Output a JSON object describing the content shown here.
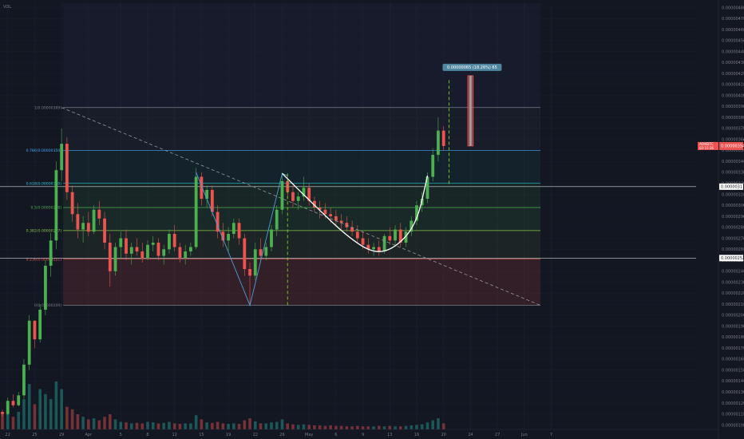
{
  "indicator_label": "VOL",
  "colors": {
    "background": "#131722",
    "up": "#26a69a",
    "down": "#ef5350",
    "up_candle": "#4caf50",
    "pattern_line": "#4f9fd8",
    "cup_line": "#ffffff",
    "target_dash": "#7ed321",
    "last_price_bg": "#ef5350"
  },
  "chart_data": {
    "type": "candlestick",
    "price_axis": {
      "ylim": [
        9.6e-07,
        4.84e-06
      ],
      "ticks": [
        "0.00000480",
        "0.00000470",
        "0.00000460",
        "0.00000450",
        "0.00000440",
        "0.00000430",
        "0.00000420",
        "0.00000410",
        "0.00000400",
        "0.00000390",
        "0.00000380",
        "0.00000370",
        "0.00000360",
        "0.00000350",
        "0.00000340",
        "0.00000330",
        "0.00000320",
        "0.00000310",
        "0.00000300",
        "0.00000290",
        "0.00000280",
        "0.00000270",
        "0.00000260",
        "0.00000250",
        "0.00000240",
        "0.00000230",
        "0.00000220",
        "0.00000210",
        "0.00000200",
        "0.00000190",
        "0.00000180",
        "0.00000170",
        "0.00000160",
        "0.00000150",
        "0.00000140",
        "0.00000130",
        "0.00000120",
        "0.00000110",
        "0.00000100"
      ],
      "badges": [
        {
          "label": "0.00000317",
          "value": 3.17e-06
        },
        {
          "label": "0.00000252",
          "value": 2.52e-06
        }
      ],
      "symbol_tag": "ARKBTC",
      "last_price": {
        "label": "0.00000354",
        "value": 3.54e-06,
        "sub": "02:15:36"
      }
    },
    "time_axis": {
      "labels": [
        "22",
        "25",
        "29",
        "Apr",
        "5",
        "8",
        "12",
        "15",
        "19",
        "22",
        "26",
        "May",
        "6",
        "9",
        "13",
        "16",
        "20",
        "24",
        "27",
        "Jun",
        "7"
      ],
      "index_positions": [
        1,
        6,
        11,
        16,
        22,
        27,
        32,
        37,
        42,
        47,
        52,
        57,
        62,
        67,
        72,
        77,
        82,
        87,
        92,
        97,
        102
      ]
    },
    "fib_levels": [
      {
        "label": "1(0.00000389)",
        "ratio": 1,
        "value": 3.89e-06
      },
      {
        "label": "0.786(0.00000350)",
        "ratio": 0.786,
        "value": 3.5e-06
      },
      {
        "label": "0.618(0.00000320)",
        "ratio": 0.618,
        "value": 3.2e-06
      },
      {
        "label": "0.5(0.00000298)",
        "ratio": 0.5,
        "value": 2.98e-06
      },
      {
        "label": "0.382(0.00000277)",
        "ratio": 0.382,
        "value": 2.77e-06
      },
      {
        "label": "0.236(0.00000251)",
        "ratio": 0.236,
        "value": 2.51e-06
      },
      {
        "label": "0(0.00000209)",
        "ratio": 0,
        "value": 2.09e-06
      }
    ],
    "fib_range_index": [
      11,
      100
    ],
    "trendline": [
      {
        "i": 11,
        "v": 3.89e-06
      },
      {
        "i": 100,
        "v": 2.09e-06
      }
    ],
    "pattern_line": [
      {
        "i": 36,
        "v": 3.3e-06
      },
      {
        "i": 46,
        "v": 2.09e-06
      },
      {
        "i": 52,
        "v": 3.29e-06
      },
      {
        "i": 53,
        "v": 3.27e-06
      }
    ],
    "cup_line": [
      {
        "i": 52,
        "v": 3.29e-06
      },
      {
        "i": 58,
        "v": 3e-06
      },
      {
        "i": 64,
        "v": 2.72e-06
      },
      {
        "i": 69,
        "v": 2.56e-06
      },
      {
        "i": 73,
        "v": 2.61e-06
      },
      {
        "i": 77,
        "v": 2.83e-06
      },
      {
        "i": 79,
        "v": 3.27e-06
      }
    ],
    "vertical_dashes": [
      {
        "i": 53,
        "from": 2.09e-06,
        "to": 3.29e-06
      },
      {
        "i": 83,
        "from": 3.17e-06,
        "to": 4.14e-06
      }
    ],
    "target_box": {
      "i_from": 86.5,
      "i_to": 87.5,
      "v_from": 3.54e-06,
      "v_to": 4.18e-06,
      "label": "0.00000065 (18.26%) 65"
    },
    "candles": [
      [
        1.12e-06,
        1.14e-06,
        1.08e-06,
        1.1e-06
      ],
      [
        1.1e-06,
        1.25e-06,
        1.09e-06,
        1.22e-06
      ],
      [
        1.22e-06,
        1.28e-06,
        1.16e-06,
        1.18e-06
      ],
      [
        1.18e-06,
        1.3e-06,
        1.17e-06,
        1.27e-06
      ],
      [
        1.27e-06,
        1.6e-06,
        1.24e-06,
        1.55e-06
      ],
      [
        1.55e-06,
        2e-06,
        1.5e-06,
        1.95e-06
      ],
      [
        1.95e-06,
        1.85e-06,
        1.7e-06,
        1.78e-06
      ],
      [
        1.78e-06,
        2.1e-06,
        1.75e-06,
        2.05e-06
      ],
      [
        2.05e-06,
        2.5e-06,
        2e-06,
        2.45e-06
      ],
      [
        2.45e-06,
        2.75e-06,
        2.35e-06,
        2.68e-06
      ],
      [
        2.68e-06,
        3.4e-06,
        2.6e-06,
        3.32e-06
      ],
      [
        3.32e-06,
        3.7e-06,
        3.22e-06,
        3.56e-06
      ],
      [
        3.56e-06,
        3.62e-06,
        3.05e-06,
        3.12e-06
      ],
      [
        3.12e-06,
        3.18e-06,
        2.85e-06,
        2.92e-06
      ],
      [
        2.92e-06,
        3.02e-06,
        2.7e-06,
        2.78e-06
      ],
      [
        2.78e-06,
        2.9e-06,
        2.66e-06,
        2.84e-06
      ],
      [
        2.84e-06,
        2.94e-06,
        2.72e-06,
        2.76e-06
      ],
      [
        2.76e-06,
        3e-06,
        2.74e-06,
        2.96e-06
      ],
      [
        2.96e-06,
        3.04e-06,
        2.82e-06,
        2.88e-06
      ],
      [
        2.88e-06,
        2.94e-06,
        2.6e-06,
        2.66e-06
      ],
      [
        2.66e-06,
        2.74e-06,
        2.26e-06,
        2.4e-06
      ],
      [
        2.4e-06,
        2.66e-06,
        2.36e-06,
        2.62e-06
      ],
      [
        2.62e-06,
        2.76e-06,
        2.52e-06,
        2.7e-06
      ],
      [
        2.7e-06,
        2.78e-06,
        2.5e-06,
        2.56e-06
      ],
      [
        2.56e-06,
        2.66e-06,
        2.46e-06,
        2.62e-06
      ],
      [
        2.62e-06,
        2.7e-06,
        2.54e-06,
        2.58e-06
      ],
      [
        2.58e-06,
        2.66e-06,
        2.48e-06,
        2.52e-06
      ],
      [
        2.52e-06,
        2.68e-06,
        2.5e-06,
        2.64e-06
      ],
      [
        2.64e-06,
        2.72e-06,
        2.58e-06,
        2.66e-06
      ],
      [
        2.66e-06,
        2.7e-06,
        2.5e-06,
        2.54e-06
      ],
      [
        2.54e-06,
        2.64e-06,
        2.46e-06,
        2.6e-06
      ],
      [
        2.6e-06,
        2.78e-06,
        2.56e-06,
        2.74e-06
      ],
      [
        2.74e-06,
        2.82e-06,
        2.58e-06,
        2.62e-06
      ],
      [
        2.62e-06,
        2.66e-06,
        2.48e-06,
        2.52e-06
      ],
      [
        2.52e-06,
        2.64e-06,
        2.46e-06,
        2.58e-06
      ],
      [
        2.58e-06,
        2.66e-06,
        2.54e-06,
        2.62e-06
      ],
      [
        2.62e-06,
        3.34e-06,
        2.6e-06,
        3.26e-06
      ],
      [
        3.26e-06,
        3.3e-06,
        3e-06,
        3.06e-06
      ],
      [
        3.06e-06,
        3.18e-06,
        2.98e-06,
        3.14e-06
      ],
      [
        3.14e-06,
        3.18e-06,
        2.9e-06,
        2.94e-06
      ],
      [
        2.94e-06,
        3e-06,
        2.7e-06,
        2.76e-06
      ],
      [
        2.76e-06,
        2.84e-06,
        2.62e-06,
        2.68e-06
      ],
      [
        2.68e-06,
        2.8e-06,
        2.58e-06,
        2.74e-06
      ],
      [
        2.74e-06,
        2.88e-06,
        2.7e-06,
        2.84e-06
      ],
      [
        2.84e-06,
        2.88e-06,
        2.64e-06,
        2.7e-06
      ],
      [
        2.7e-06,
        2.74e-06,
        2.36e-06,
        2.42e-06
      ],
      [
        2.42e-06,
        2.48e-06,
        2.09e-06,
        2.36e-06
      ],
      [
        2.36e-06,
        2.66e-06,
        2.32e-06,
        2.6e-06
      ],
      [
        2.6e-06,
        2.7e-06,
        2.5e-06,
        2.54e-06
      ],
      [
        2.54e-06,
        2.66e-06,
        2.5e-06,
        2.62e-06
      ],
      [
        2.62e-06,
        2.82e-06,
        2.58e-06,
        2.78e-06
      ],
      [
        2.78e-06,
        3e-06,
        2.72e-06,
        2.96e-06
      ],
      [
        2.96e-06,
        3.3e-06,
        2.92e-06,
        3.22e-06
      ],
      [
        3.22e-06,
        3.28e-06,
        3.06e-06,
        3.12e-06
      ],
      [
        3.12e-06,
        3.18e-06,
        2.98e-06,
        3.04e-06
      ],
      [
        3.04e-06,
        3.12e-06,
        2.96e-06,
        3.08e-06
      ],
      [
        3.08e-06,
        3.26e-06,
        3.04e-06,
        3.16e-06
      ],
      [
        3.16e-06,
        3.2e-06,
        3e-06,
        3.04e-06
      ],
      [
        3.04e-06,
        3.08e-06,
        2.94e-06,
        2.98e-06
      ],
      [
        2.98e-06,
        3.04e-06,
        2.88e-06,
        2.96e-06
      ],
      [
        2.96e-06,
        3.02e-06,
        2.88e-06,
        2.92e-06
      ],
      [
        2.92e-06,
        2.98e-06,
        2.84e-06,
        2.9e-06
      ],
      [
        2.9e-06,
        2.96e-06,
        2.82e-06,
        2.86e-06
      ],
      [
        2.86e-06,
        2.92e-06,
        2.78e-06,
        2.84e-06
      ],
      [
        2.84e-06,
        2.9e-06,
        2.76e-06,
        2.8e-06
      ],
      [
        2.8e-06,
        2.86e-06,
        2.72e-06,
        2.76e-06
      ],
      [
        2.76e-06,
        2.82e-06,
        2.66e-06,
        2.7e-06
      ],
      [
        2.7e-06,
        2.76e-06,
        2.6e-06,
        2.64e-06
      ],
      [
        2.64e-06,
        2.7e-06,
        2.56e-06,
        2.6e-06
      ],
      [
        2.6e-06,
        2.66e-06,
        2.54e-06,
        2.62e-06
      ],
      [
        2.62e-06,
        2.68e-06,
        2.54e-06,
        2.58e-06
      ],
      [
        2.58e-06,
        2.74e-06,
        2.56e-06,
        2.72e-06
      ],
      [
        2.72e-06,
        2.8e-06,
        2.64e-06,
        2.68e-06
      ],
      [
        2.68e-06,
        2.82e-06,
        2.64e-06,
        2.78e-06
      ],
      [
        2.78e-06,
        2.84e-06,
        2.62e-06,
        2.66e-06
      ],
      [
        2.66e-06,
        2.8e-06,
        2.62e-06,
        2.76e-06
      ],
      [
        2.76e-06,
        2.9e-06,
        2.72e-06,
        2.86e-06
      ],
      [
        2.86e-06,
        3.04e-06,
        2.82e-06,
        3e-06
      ],
      [
        3e-06,
        3.12e-06,
        2.94e-06,
        3.06e-06
      ],
      [
        3.06e-06,
        3.3e-06,
        3.02e-06,
        3.26e-06
      ],
      [
        3.26e-06,
        3.52e-06,
        3.22e-06,
        3.46e-06
      ],
      [
        3.46e-06,
        3.8e-06,
        3.4e-06,
        3.68e-06
      ],
      [
        3.68e-06,
        3.72e-06,
        3.5e-06,
        3.54e-06
      ]
    ],
    "volume_colors_note": "",
    "volumes": [
      30,
      40,
      25,
      35,
      60,
      90,
      50,
      80,
      70,
      60,
      95,
      80,
      45,
      40,
      30,
      25,
      20,
      22,
      18,
      25,
      30,
      20,
      15,
      14,
      12,
      13,
      12,
      15,
      14,
      12,
      13,
      15,
      12,
      11,
      12,
      12,
      28,
      20,
      14,
      13,
      15,
      12,
      11,
      12,
      11,
      18,
      22,
      16,
      12,
      12,
      14,
      15,
      20,
      12,
      10,
      9,
      10,
      9,
      8,
      8,
      7,
      8,
      7,
      7,
      6,
      6,
      7,
      6,
      6,
      6,
      7,
      6,
      7,
      6,
      6,
      7,
      8,
      9,
      10,
      14,
      18,
      22,
      12
    ]
  }
}
